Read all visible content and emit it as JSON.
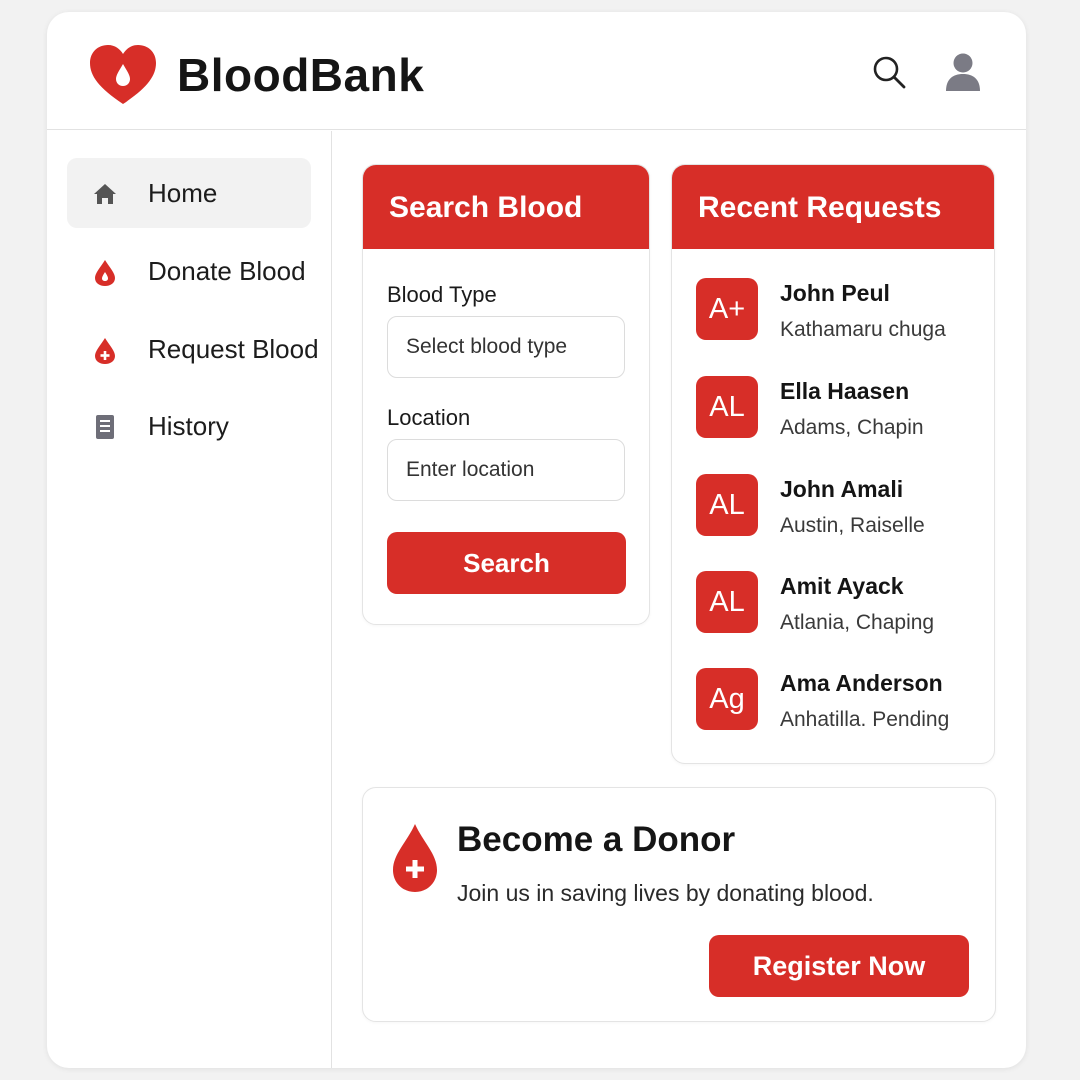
{
  "app": {
    "brand": "BloodBank",
    "accent_color": "#d72e28",
    "header_icons": [
      "search-icon",
      "user-icon"
    ]
  },
  "sidebar": {
    "items": [
      {
        "label": "Home",
        "icon": "home-icon",
        "active": true
      },
      {
        "label": "Donate Blood",
        "icon": "blood-drop-icon",
        "active": false
      },
      {
        "label": "Request Blood",
        "icon": "blood-drop-plus-icon",
        "active": false
      },
      {
        "label": "History",
        "icon": "document-icon",
        "active": false
      }
    ]
  },
  "search_card": {
    "title": "Search Blood",
    "blood_type_label": "Blood Type",
    "blood_type_placeholder": "Select blood type",
    "location_label": "Location",
    "location_placeholder": "Enter location",
    "button_label": "Search"
  },
  "requests_card": {
    "title": "Recent Requests",
    "items": [
      {
        "badge": "A+",
        "name": "John Peul",
        "location": "Kathamaru chuga"
      },
      {
        "badge": "AL",
        "name": "Ella Haasen",
        "location": "Adams, Chapin"
      },
      {
        "badge": "AL",
        "name": "John Amali",
        "location": "Austin, Raiselle"
      },
      {
        "badge": "AL",
        "name": "Amit Ayack",
        "location": "Atlania, Chaping"
      },
      {
        "badge": "Ag",
        "name": "Ama Anderson",
        "location": "Anhatilla. Pending"
      }
    ]
  },
  "donor_card": {
    "title": "Become a Donor",
    "text": "Join us in saving lives by donating blood.",
    "button_label": "Register Now",
    "icon": "blood-drop-plus-icon"
  }
}
